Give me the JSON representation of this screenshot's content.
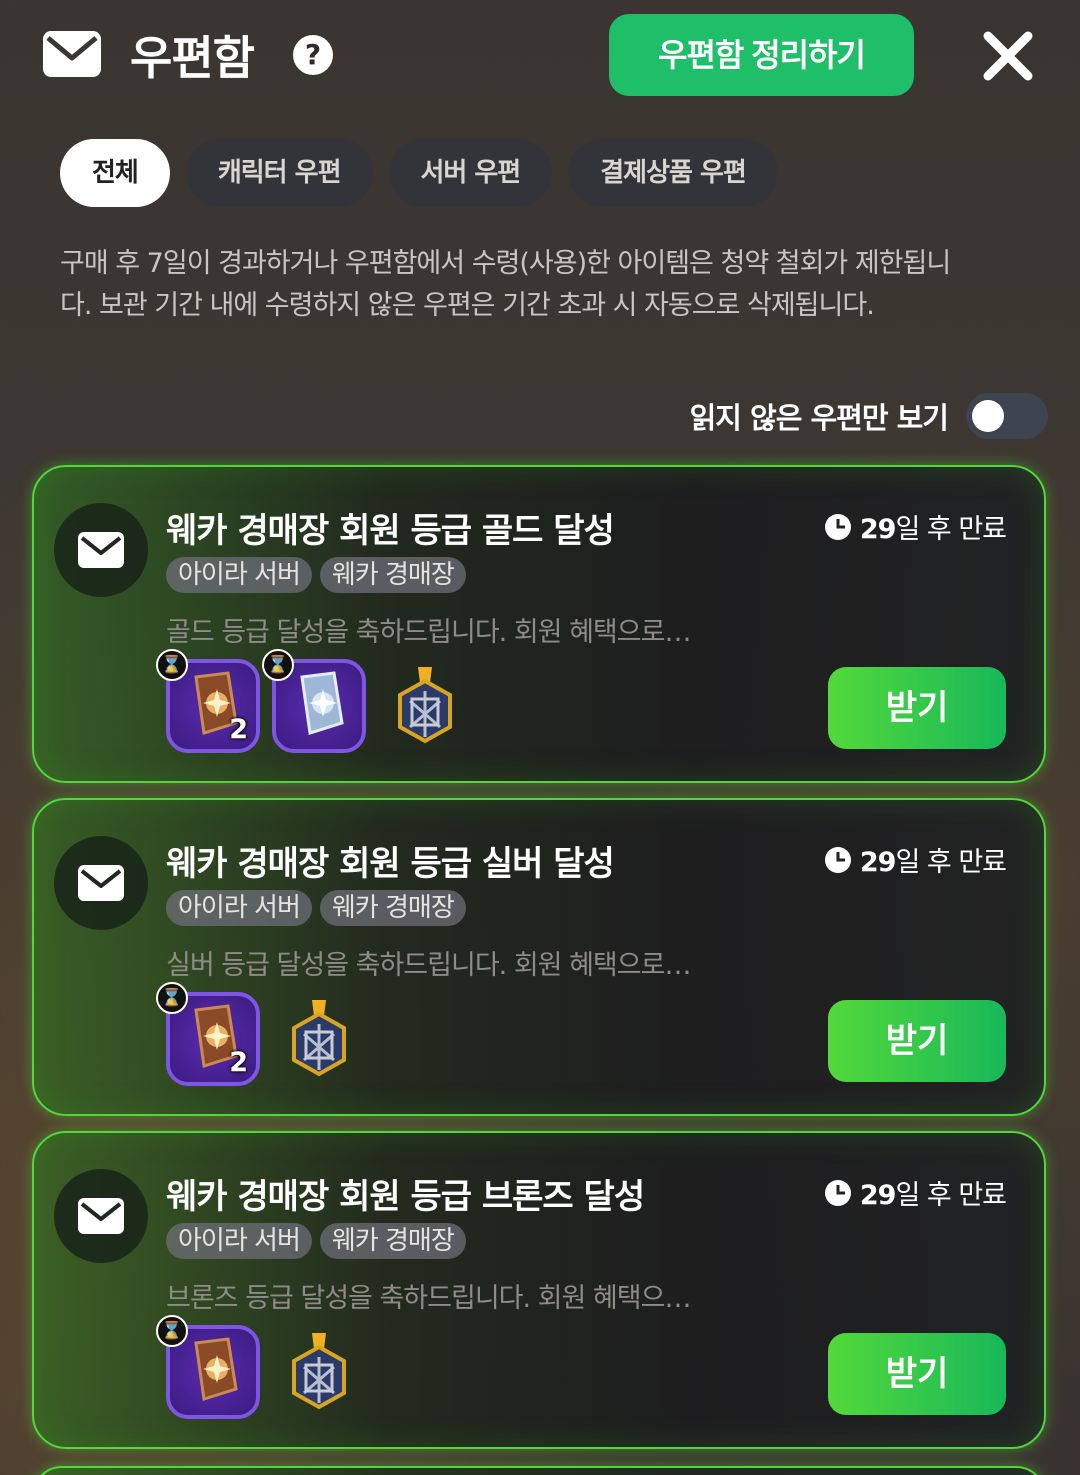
{
  "header": {
    "title": "우편함",
    "help_icon": "?",
    "organize_label": "우편함 정리하기",
    "close_icon": "close-icon"
  },
  "tabs": [
    {
      "label": "전체",
      "active": true
    },
    {
      "label": "캐릭터 우편",
      "active": false
    },
    {
      "label": "서버 우편",
      "active": false
    },
    {
      "label": "결제상품 우편",
      "active": false
    }
  ],
  "notice": "구매 후 7일이 경과하거나 우편함에서 수령(사용)한 아이템은 청약 철회가 제한됩니다. 보관 기간 내에 수령하지 않은 우편은 기간 초과 시 자동으로 삭제됩니다.",
  "unread_toggle": {
    "label": "읽지 않은 우편만 보기",
    "on": false
  },
  "mails": [
    {
      "title": "웨카 경매장 회원 등급 골드 달성",
      "expiry_days": "29",
      "expiry_suffix": "일 후 만료",
      "tags": [
        "아이라 서버",
        "웨카 경매장"
      ],
      "preview": "골드 등급 달성을 축하드립니다. 회원 혜택으로…",
      "items": [
        {
          "type": "boxed",
          "icon": "bronze-tag-icon",
          "qty": "2",
          "timer": "⌛"
        },
        {
          "type": "boxed",
          "icon": "silver-tag-icon",
          "qty": "",
          "timer": "⌛"
        },
        {
          "type": "plain",
          "icon": "medal-icon"
        }
      ],
      "receive_label": "받기"
    },
    {
      "title": "웨카 경매장 회원 등급 실버 달성",
      "expiry_days": "29",
      "expiry_suffix": "일 후 만료",
      "tags": [
        "아이라 서버",
        "웨카 경매장"
      ],
      "preview": "실버 등급 달성을 축하드립니다. 회원 혜택으로…",
      "items": [
        {
          "type": "boxed",
          "icon": "bronze-tag-icon",
          "qty": "2",
          "timer": "⌛"
        },
        {
          "type": "plain",
          "icon": "medal-icon"
        }
      ],
      "receive_label": "받기"
    },
    {
      "title": "웨카 경매장 회원 등급 브론즈 달성",
      "expiry_days": "29",
      "expiry_suffix": "일 후 만료",
      "tags": [
        "아이라 서버",
        "웨카 경매장"
      ],
      "preview": "브론즈 등급 달성을 축하드립니다. 회원 혜택으…",
      "items": [
        {
          "type": "boxed",
          "icon": "bronze-tag-icon",
          "qty": "",
          "timer": "⌛"
        },
        {
          "type": "plain",
          "icon": "medal-icon"
        }
      ],
      "receive_label": "받기"
    }
  ],
  "colors": {
    "accent_green": "#1fbf6a",
    "card_border": "#4fd838",
    "item_frame": "#7f55e6"
  }
}
